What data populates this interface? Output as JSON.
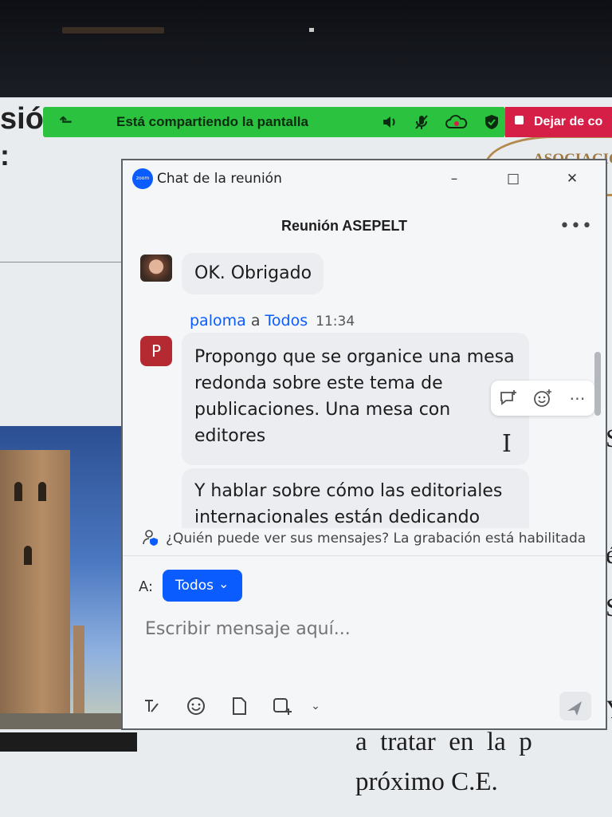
{
  "slide": {
    "title_fragment": "sión",
    "colon": ":",
    "right_letters": [
      "S",
      "é",
      "S",
      "Y"
    ],
    "bottom_line1": "a  tratar  en  la  p",
    "bottom_line2": "próximo C.E.",
    "logo_text": "ASOCIACIÓN"
  },
  "share_bar": {
    "text": "Está compartiendo la pantalla",
    "stop_label": "Dejar de co",
    "colors": {
      "bar": "#2ac23e",
      "stop": "#d61f47"
    }
  },
  "chat": {
    "window_title": "Chat de la reunión",
    "logo_text": "zoom",
    "meeting_name": "Reunión ASEPELT",
    "messages": [
      {
        "text": "OK. Obrigado"
      },
      {
        "sender": "paloma",
        "to_word": "a",
        "recipient": "Todos",
        "time": "11:34",
        "avatar_letter": "P",
        "text": "Propongo que se organice una mesa redonda sobre este tema de publicaciones. Una mesa con editores",
        "text2": "Y hablar sobre cómo las editoriales internacionales están dedicando"
      }
    ],
    "privacy_notice": "¿Quién puede ver sus mensajes? La grabación está habilitada",
    "to_label": "A:",
    "recipient_button": "Todos",
    "input_placeholder": "Escribir mensaje aquí..."
  }
}
